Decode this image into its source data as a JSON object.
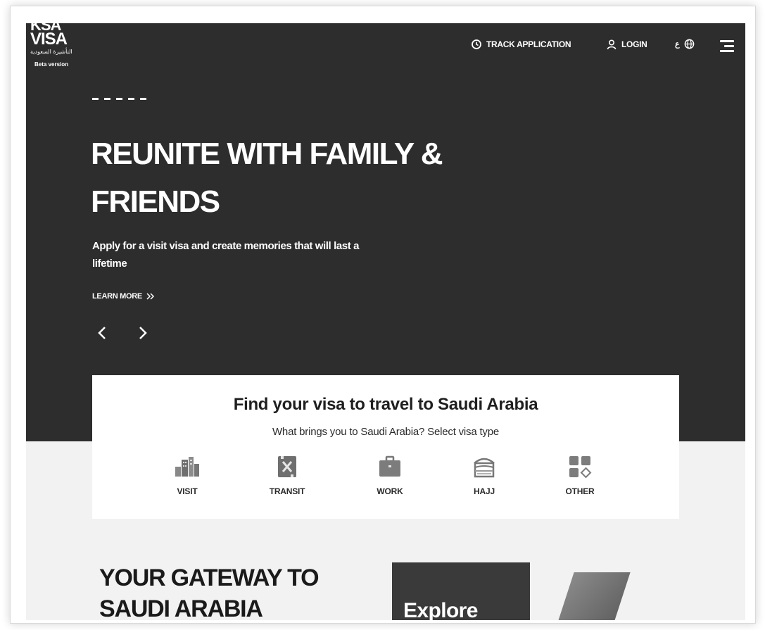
{
  "logo": {
    "line1": "KSA",
    "line2": "VISA",
    "arabic": "التأشيرة السعودية",
    "beta": "Beta version"
  },
  "nav": {
    "track": "TRACK APPLICATION",
    "login": "LOGIN",
    "lang": "ع"
  },
  "hero": {
    "title": "REUNITE WITH FAMILY & FRIENDS",
    "subtitle": "Apply for a visit visa and create memories that will last a lifetime",
    "learn_more": "LEARN MORE"
  },
  "visa_finder": {
    "title": "Find your visa to travel to Saudi Arabia",
    "subtitle": "What brings you to Saudi Arabia? Select visa type",
    "types": [
      {
        "label": "VISIT",
        "icon": "city-buildings-icon"
      },
      {
        "label": "TRANSIT",
        "icon": "transit-icon"
      },
      {
        "label": "WORK",
        "icon": "briefcase-icon"
      },
      {
        "label": "HAJJ",
        "icon": "kaaba-icon"
      },
      {
        "label": "OTHER",
        "icon": "grid-shapes-icon"
      }
    ]
  },
  "gateway": {
    "title": "YOUR GATEWAY TO SAUDI ARABIA",
    "explore": "Explore"
  },
  "colors": {
    "hero_bg": "#2d2d2d",
    "page_bg": "#f2f2f2",
    "card_bg": "#ffffff",
    "text_dark": "#1a1a1a"
  }
}
